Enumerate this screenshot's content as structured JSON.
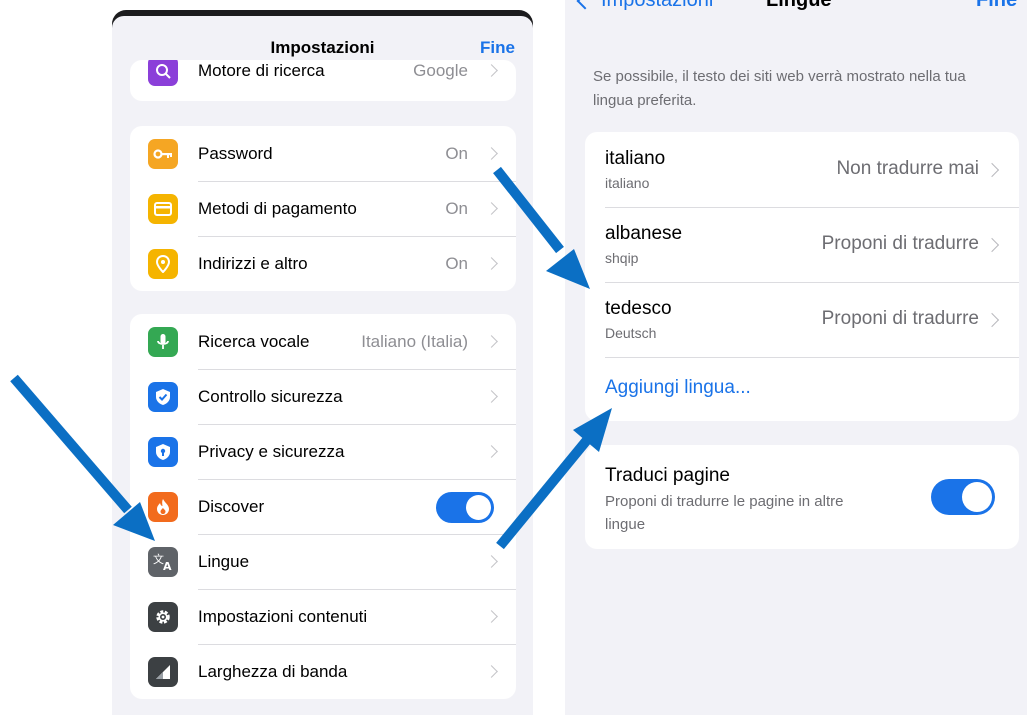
{
  "left": {
    "title": "Impostazioni",
    "done": "Fine",
    "partial_row": {
      "label": "Motore di ricerca",
      "value": "Google"
    },
    "group1": [
      {
        "label": "Password",
        "value": "On",
        "icon": "key-icon",
        "color": "#f5a623"
      },
      {
        "label": "Metodi di pagamento",
        "value": "On",
        "icon": "card-icon",
        "color": "#f5b400"
      },
      {
        "label": "Indirizzi e altro",
        "value": "On",
        "icon": "location-pin-icon",
        "color": "#f5b400"
      }
    ],
    "group2": [
      {
        "label": "Ricerca vocale",
        "value": "Italiano (Italia)",
        "icon": "microphone-icon",
        "color": "#34a853"
      },
      {
        "label": "Controllo sicurezza",
        "value": "",
        "icon": "shield-check-icon",
        "color": "#1a73e8"
      },
      {
        "label": "Privacy e sicurezza",
        "value": "",
        "icon": "shield-lock-icon",
        "color": "#1a73e8"
      },
      {
        "label": "Discover",
        "value": "",
        "icon": "flame-icon",
        "color": "#f26b1d",
        "toggle": true
      },
      {
        "label": "Lingue",
        "value": "",
        "icon": "translate-icon",
        "color": "#5f6368"
      },
      {
        "label": "Impostazioni contenuti",
        "value": "",
        "icon": "gear-icon",
        "color": "#3c4043"
      },
      {
        "label": "Larghezza di banda",
        "value": "",
        "icon": "signal-icon",
        "color": "#3c4043"
      }
    ]
  },
  "right": {
    "back": "Impostazioni",
    "title": "Lingue",
    "done": "Fine",
    "description": "Se possibile, il testo dei siti web verrà mostrato nella tua lingua preferita.",
    "languages": [
      {
        "name": "italiano",
        "native": "italiano",
        "setting": "Non tradurre mai"
      },
      {
        "name": "albanese",
        "native": "shqip",
        "setting": "Proponi di tradurre"
      },
      {
        "name": "tedesco",
        "native": "Deutsch",
        "setting": "Proponi di tradurre"
      }
    ],
    "add_language": "Aggiungi lingua...",
    "translate": {
      "title": "Traduci pagine",
      "description": "Proponi di tradurre le pagine in altre lingue",
      "enabled": true
    }
  },
  "colors": {
    "accent": "#1a73e8",
    "arrow": "#0b6fc4",
    "background": "#f2f2f7"
  }
}
